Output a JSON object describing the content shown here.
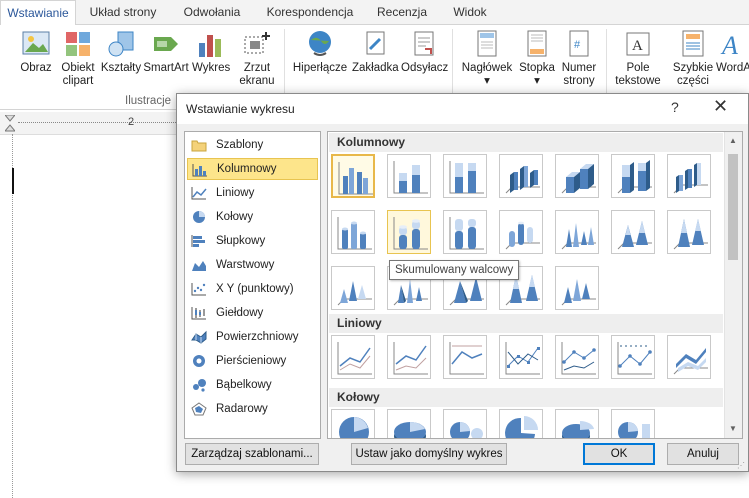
{
  "ribbon": {
    "tabs": [
      "Wstawianie",
      "Układ strony",
      "Odwołania",
      "Korespondencja",
      "Recenzja",
      "Widok"
    ],
    "buttons": [
      {
        "label": "Obraz",
        "icon": "picture-icon"
      },
      {
        "label": "Obiekt clipart",
        "icon": "clipart-icon"
      },
      {
        "label": "Kształty",
        "icon": "shapes-icon"
      },
      {
        "label": "SmartArt",
        "icon": "smartart-icon"
      },
      {
        "label": "Wykres",
        "icon": "chart-icon"
      },
      {
        "label": "Zrzut ekranu",
        "icon": "screenshot-icon"
      },
      {
        "label": "Hiperłącze",
        "icon": "hyperlink-icon"
      },
      {
        "label": "Zakładka",
        "icon": "bookmark-icon"
      },
      {
        "label": "Odsyłacz",
        "icon": "cross-reference-icon"
      },
      {
        "label": "Nagłówek",
        "icon": "header-icon"
      },
      {
        "label": "Stopka",
        "icon": "footer-icon"
      },
      {
        "label": "Numer strony",
        "icon": "page-number-icon"
      },
      {
        "label": "Pole tekstowe",
        "icon": "textbox-icon"
      },
      {
        "label": "Szybkie części",
        "icon": "quick-parts-icon"
      },
      {
        "label": "WordA",
        "icon": "wordart-icon"
      }
    ],
    "group_label": "Ilustracje"
  },
  "ruler": {
    "mark": "2"
  },
  "dialog": {
    "title": "Wstawianie wykresu",
    "help": "?",
    "close": "✕",
    "categories": [
      {
        "label": "Szablony",
        "icon": "folder-icon"
      },
      {
        "label": "Kolumnowy",
        "icon": "column-chart-icon"
      },
      {
        "label": "Liniowy",
        "icon": "line-chart-icon"
      },
      {
        "label": "Kołowy",
        "icon": "pie-chart-icon"
      },
      {
        "label": "Słupkowy",
        "icon": "bar-chart-icon"
      },
      {
        "label": "Warstwowy",
        "icon": "area-chart-icon"
      },
      {
        "label": "X Y (punktowy)",
        "icon": "scatter-chart-icon"
      },
      {
        "label": "Giełdowy",
        "icon": "stock-chart-icon"
      },
      {
        "label": "Powierzchniowy",
        "icon": "surface-chart-icon"
      },
      {
        "label": "Pierścieniowy",
        "icon": "doughnut-chart-icon"
      },
      {
        "label": "Bąbelkowy",
        "icon": "bubble-chart-icon"
      },
      {
        "label": "Radarowy",
        "icon": "radar-chart-icon"
      }
    ],
    "selected_category": "Kolumnowy",
    "sections": {
      "column": "Kolumnowy",
      "line": "Liniowy",
      "pie": "Kołowy"
    },
    "tooltip": "Skumulowany walcowy",
    "buttons": {
      "manage": "Zarządzaj szablonami...",
      "set_default": "Ustaw jako domyślny wykres",
      "ok": "OK",
      "cancel": "Anuluj"
    }
  },
  "colors": {
    "accent": "#2b579a",
    "selection": "#fde58b",
    "chart_blue": "#4f81bd"
  }
}
